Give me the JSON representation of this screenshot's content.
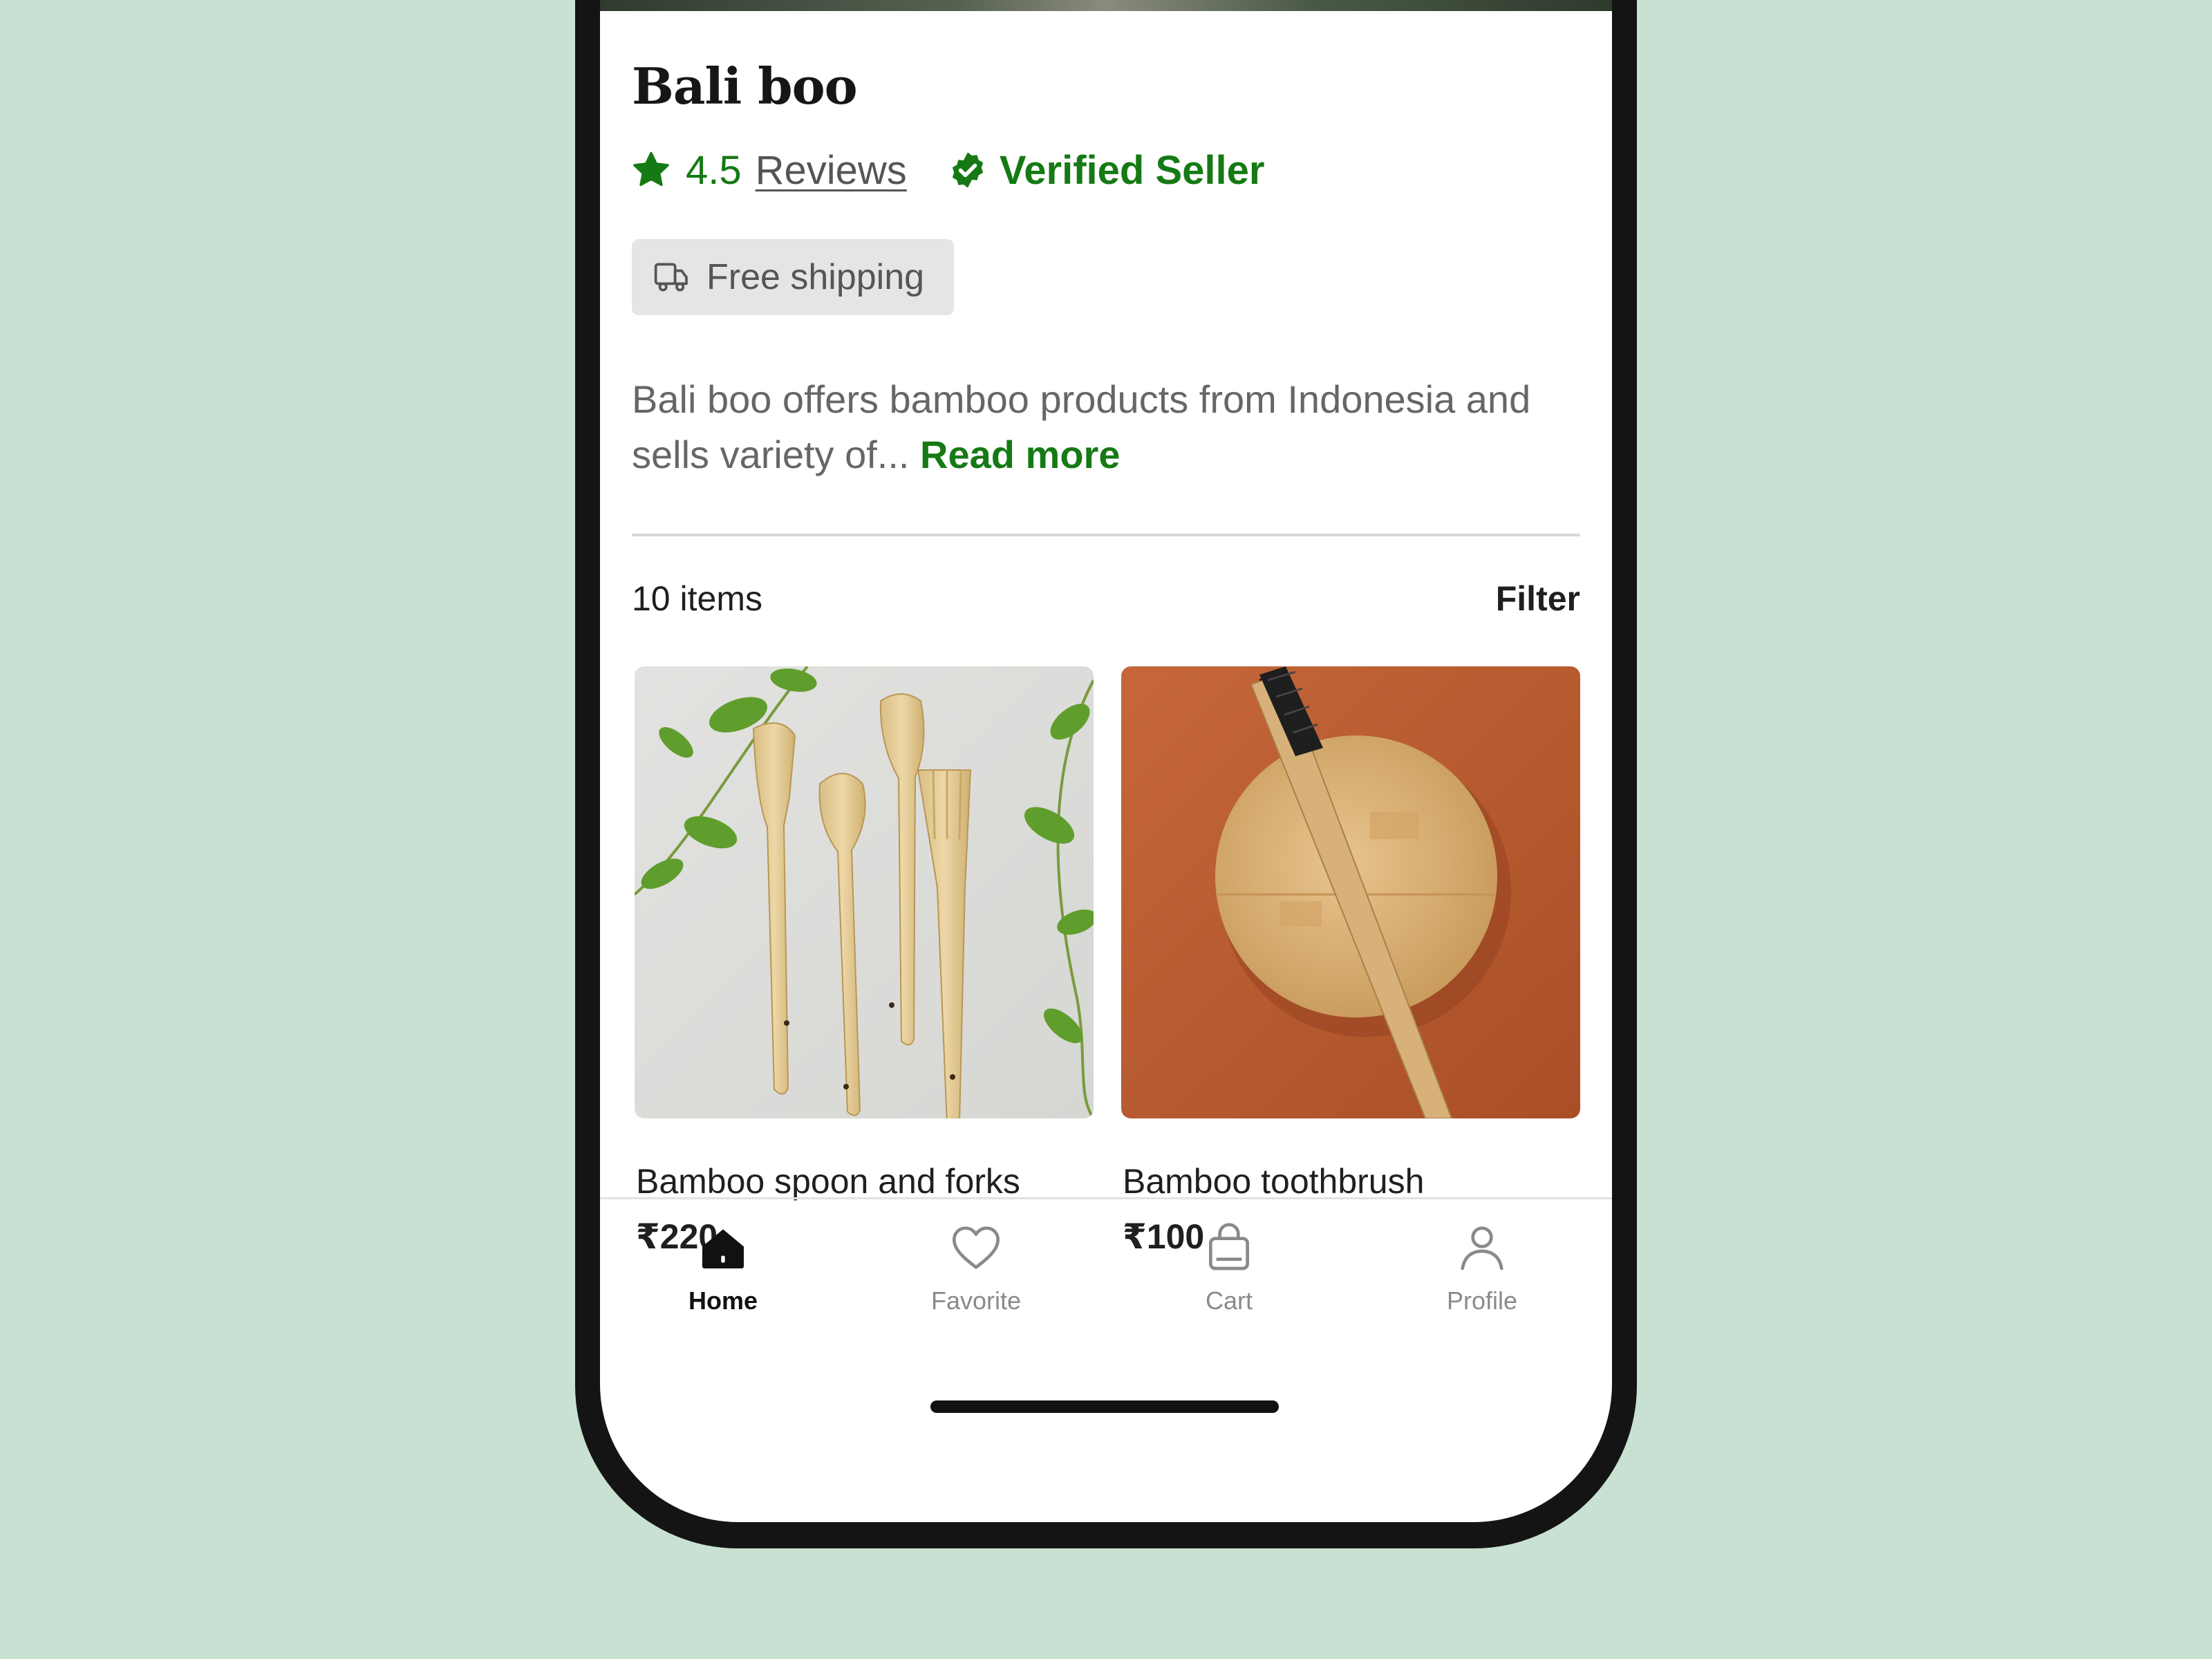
{
  "shop": {
    "title": "Bali boo",
    "rating": "4.5",
    "reviews_label": "Reviews",
    "verified_label": "Verified Seller",
    "shipping_label": "Free shipping",
    "description": "Bali boo offers bamboo products from Indonesia and sells variety of...",
    "read_more_label": "Read more"
  },
  "listing": {
    "count_label": "10 items",
    "filter_label": "Filter"
  },
  "products": [
    {
      "name": "Bamboo spoon and forks",
      "price": "₹220"
    },
    {
      "name": "Bamboo toothbrush",
      "price": "₹100"
    }
  ],
  "tabbar": {
    "tabs": [
      {
        "label": "Home",
        "icon": "home-icon",
        "active": true
      },
      {
        "label": "Favorite",
        "icon": "heart-icon",
        "active": false
      },
      {
        "label": "Cart",
        "icon": "bag-icon",
        "active": false
      },
      {
        "label": "Profile",
        "icon": "person-icon",
        "active": false
      }
    ]
  },
  "colors": {
    "accent_green": "#157a14",
    "background": "#c9e1d2",
    "badge_bg": "#e5e5e5"
  }
}
